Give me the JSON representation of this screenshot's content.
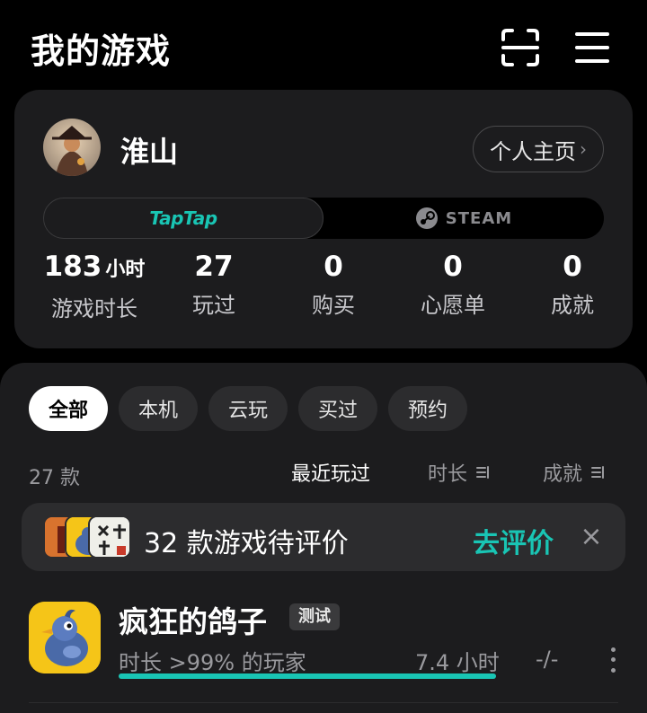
{
  "header": {
    "title": "我的游戏",
    "scan_icon": "scan-icon",
    "menu_icon": "menu-icon"
  },
  "profile": {
    "username": "淮山",
    "profile_link_label": "个人主页",
    "platforms": [
      {
        "label": "TapTap",
        "active": true
      },
      {
        "label": "STEAM",
        "active": false
      }
    ],
    "stats": [
      {
        "value": "183",
        "unit": "小时",
        "label": "游戏时长"
      },
      {
        "value": "27",
        "unit": "",
        "label": "玩过"
      },
      {
        "value": "0",
        "unit": "",
        "label": "购买"
      },
      {
        "value": "0",
        "unit": "",
        "label": "心愿单"
      },
      {
        "value": "0",
        "unit": "",
        "label": "成就"
      }
    ]
  },
  "filters": [
    "全部",
    "本机",
    "云玩",
    "买过",
    "预约"
  ],
  "list": {
    "count_label": "27 款",
    "sort_options": [
      {
        "label": "最近玩过",
        "active": true
      },
      {
        "label": "时长",
        "active": false
      },
      {
        "label": "成就",
        "active": false
      }
    ]
  },
  "review_banner": {
    "text": "32 款游戏待评价",
    "cta": "去评价",
    "close_icon": "close-icon"
  },
  "games": [
    {
      "name": "疯狂的鸽子",
      "badge": "测试",
      "playtime_label": "时长 >99% 的玩家",
      "playtime_value": "7.4 小时",
      "playtime_progress": 1.0,
      "achievement_value": "-/-"
    }
  ],
  "colors": {
    "accent": "#19c5b4",
    "card": "#1c1c1e",
    "chip": "#2c2c2e"
  }
}
